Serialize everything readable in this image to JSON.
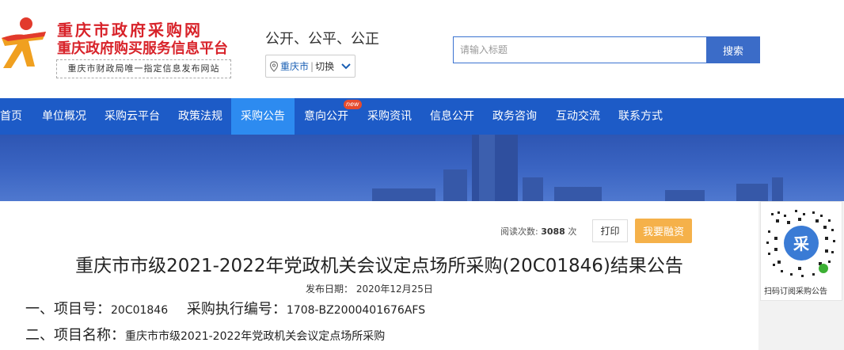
{
  "header": {
    "site_name_line1": "重庆市政府采购网",
    "site_name_line2": "重庆政府购买服务信息平台",
    "tagline": "重庆市财政局唯一指定信息发布网站",
    "slogan": "公开、公平、公正",
    "city": "重庆市",
    "city_switch": "切换",
    "search_placeholder": "请输入标题",
    "search_button": "搜索",
    "brand_color": "#d8232a"
  },
  "nav": {
    "items": [
      {
        "label": "首页"
      },
      {
        "label": "单位概况"
      },
      {
        "label": "采购云平台"
      },
      {
        "label": "政策法规"
      },
      {
        "label": "采购公告",
        "active": true
      },
      {
        "label": "意向公开",
        "badge": "new"
      },
      {
        "label": "采购资讯"
      },
      {
        "label": "信息公开"
      },
      {
        "label": "政务咨询"
      },
      {
        "label": "互动交流"
      },
      {
        "label": "联系方式"
      }
    ],
    "bg_color": "#1d5bc7",
    "active_color": "#2d8bf0"
  },
  "article": {
    "read_label": "阅读次数:",
    "read_count": "3088",
    "read_unit": "次",
    "print_button": "打印",
    "finance_button": "我要融资",
    "title": "重庆市市级2021-2022年党政机关会议定点场所采购(20C01846)结果公告",
    "publish_date": "发布日期： 2020年12月25日",
    "item1_label": "一、项目号：",
    "item1_value": "20C01846",
    "item1_exec_label": "采购执行编号：",
    "item1_exec_value": "1708-BZ2000401676AFS",
    "item2_label": "二、项目名称：",
    "item2_value": "重庆市市级2021-2022年党政机关会议定点场所采购"
  },
  "side": {
    "qr_caption": "扫码订阅采购公告"
  }
}
